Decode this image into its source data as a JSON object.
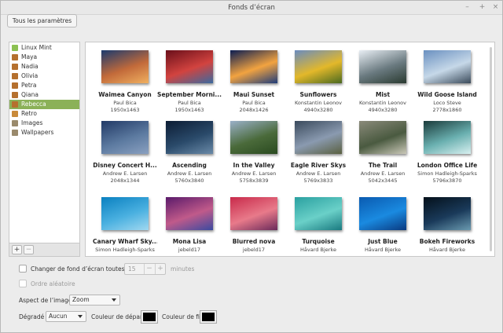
{
  "window": {
    "title": "Fonds d’écran",
    "minimize": "–",
    "maximize": "+",
    "close": "×"
  },
  "all_settings_button": "Tous les paramètres",
  "sidebar": {
    "items": [
      {
        "label": "Linux Mint",
        "icon": "mint-icon",
        "color": "#8cc152"
      },
      {
        "label": "Maya",
        "icon": "folder-picture-icon",
        "color": "#b5702e"
      },
      {
        "label": "Nadia",
        "icon": "folder-picture-icon",
        "color": "#b5702e"
      },
      {
        "label": "Olivia",
        "icon": "folder-picture-icon",
        "color": "#b5702e"
      },
      {
        "label": "Petra",
        "icon": "folder-picture-icon",
        "color": "#b5702e"
      },
      {
        "label": "Qiana",
        "icon": "folder-picture-icon",
        "color": "#b5702e"
      },
      {
        "label": "Rebecca",
        "icon": "folder-picture-icon",
        "color": "#b5702e",
        "selected": true
      },
      {
        "label": "Retro",
        "icon": "retro-icon",
        "color": "#c98a3a"
      },
      {
        "label": "Images",
        "icon": "folder-icon",
        "color": "#9a8a6c"
      },
      {
        "label": "Wallpapers",
        "icon": "folder-icon",
        "color": "#9a8a6c"
      }
    ],
    "add": "+",
    "remove": "−"
  },
  "wallpapers": [
    {
      "name": "Waimea Canyon",
      "author": "Paul Bica",
      "size": "1950x1463",
      "colors": [
        "#1b3a6e",
        "#c26a3a",
        "#f0b060"
      ]
    },
    {
      "name": "September Morni...",
      "author": "Paul Bica",
      "size": "1950x1463",
      "colors": [
        "#6a0f1a",
        "#d2433f",
        "#3a6aa0"
      ]
    },
    {
      "name": "Maui Sunset",
      "author": "Paul Bica",
      "size": "2048x1426",
      "colors": [
        "#0b1d52",
        "#f2a340",
        "#1e3c7a"
      ]
    },
    {
      "name": "Sunflowers",
      "author": "Konstantin Leonov",
      "size": "4940x3280",
      "colors": [
        "#6a8cc0",
        "#e3b82a",
        "#4a6a20"
      ]
    },
    {
      "name": "Mist",
      "author": "Konstantin Leonov",
      "size": "4940x3280",
      "colors": [
        "#e8eef4",
        "#6a7a80",
        "#2a3a30"
      ]
    },
    {
      "name": "Wild Goose Island",
      "author": "Loco Steve",
      "size": "2778x1860",
      "colors": [
        "#6a90c0",
        "#c6d8e8",
        "#3a4a5a"
      ]
    },
    {
      "name": "Disney Concert H...",
      "author": "Andrew E. Larsen",
      "size": "2048x1344",
      "colors": [
        "#223a66",
        "#5c7aa0",
        "#8aa0c0"
      ]
    },
    {
      "name": "Ascending",
      "author": "Andrew E. Larsen",
      "size": "5760x3840",
      "colors": [
        "#0c1c34",
        "#2a4a6a",
        "#6a8aa8"
      ]
    },
    {
      "name": "In the Valley",
      "author": "Andrew E. Larsen",
      "size": "5758x3839",
      "colors": [
        "#9ab0c8",
        "#4a6a3a",
        "#2a4a20"
      ]
    },
    {
      "name": "Eagle River Skys",
      "author": "Andrew E. Larsen",
      "size": "5769x3833",
      "colors": [
        "#3a4a5c",
        "#8a9ab0",
        "#5a6040"
      ]
    },
    {
      "name": "The Trail",
      "author": "Andrew E. Larsen",
      "size": "5042x3445",
      "colors": [
        "#8a8a7a",
        "#4a5a40",
        "#cac8b8"
      ]
    },
    {
      "name": "London Office Life",
      "author": "Simon Hadleigh-Sparks",
      "size": "5796x3870",
      "colors": [
        "#1a3a3a",
        "#6ab0b0",
        "#d8f0f0"
      ]
    },
    {
      "name": "Canary Wharf Sky...",
      "author": "Simon Hadleigh-Sparks",
      "size": "",
      "colors": [
        "#0a80c0",
        "#4ab0e0",
        "#a0d8f0"
      ]
    },
    {
      "name": "Mona Lisa",
      "author": "jebeld17",
      "size": "",
      "colors": [
        "#5a1a6a",
        "#c05a8a",
        "#3a4aa0"
      ]
    },
    {
      "name": "Blurred nova",
      "author": "jebeld17",
      "size": "",
      "colors": [
        "#c82a4a",
        "#e87a8a",
        "#6a2a5a"
      ]
    },
    {
      "name": "Turquoise",
      "author": "Håvard Bjerke",
      "size": "",
      "colors": [
        "#2aa0a0",
        "#6ad0c8",
        "#1a7a80"
      ]
    },
    {
      "name": "Just Blue",
      "author": "Håvard Bjerke",
      "size": "",
      "colors": [
        "#0a5ab0",
        "#1a8ae0",
        "#0a3a80"
      ]
    },
    {
      "name": "Bokeh Fireworks",
      "author": "Håvard Bjerke",
      "size": "",
      "colors": [
        "#04101a",
        "#1a3a5a",
        "#6a9ab0"
      ]
    }
  ],
  "slideshow": {
    "label": "Changer de fond d’écran toutes les",
    "value": "15",
    "unit": "minutes",
    "checked": false
  },
  "random": {
    "label": "Ordre aléatoire",
    "checked": false
  },
  "aspect": {
    "label": "Aspect de l’image",
    "value": "Zoom"
  },
  "gradient": {
    "label": "Dégradé",
    "value": "Aucun",
    "start_label": "Couleur de départ",
    "end_label": "Couleur de fin",
    "start_color": "#000000",
    "end_color": "#000000"
  }
}
